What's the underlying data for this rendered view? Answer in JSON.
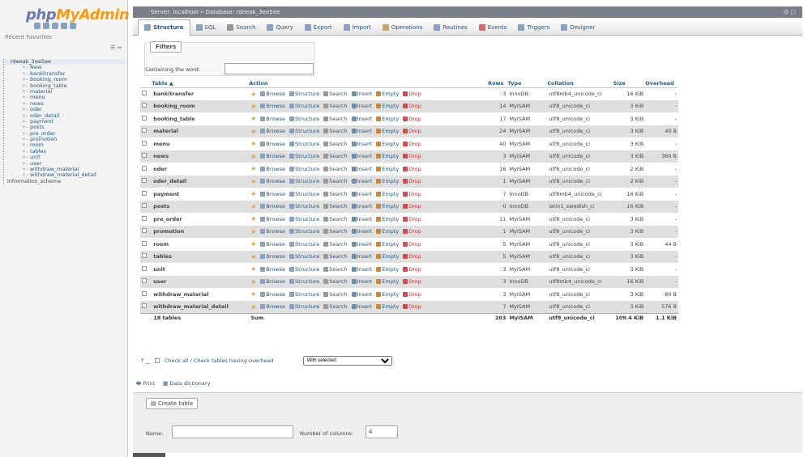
{
  "sidebar": {
    "logo_part1": "php",
    "logo_part2": "MyAdmin",
    "recent_favorites": "Recent   Favorites",
    "collapse": "☰ ⇔",
    "tree": [
      {
        "label": "rdeeak_3ee5ee",
        "type": "root"
      },
      {
        "label": "New",
        "type": "child"
      },
      {
        "label": "bankitransfer",
        "type": "child"
      },
      {
        "label": "booking_room",
        "type": "child"
      },
      {
        "label": "booking_table",
        "type": "child"
      },
      {
        "label": "material",
        "type": "child"
      },
      {
        "label": "menu",
        "type": "child"
      },
      {
        "label": "news",
        "type": "child"
      },
      {
        "label": "oder",
        "type": "child"
      },
      {
        "label": "oder_detail",
        "type": "child"
      },
      {
        "label": "payment",
        "type": "child"
      },
      {
        "label": "posts",
        "type": "child"
      },
      {
        "label": "pre_order",
        "type": "child"
      },
      {
        "label": "promotion",
        "type": "child"
      },
      {
        "label": "room",
        "type": "child"
      },
      {
        "label": "tables",
        "type": "child"
      },
      {
        "label": "unit",
        "type": "child"
      },
      {
        "label": "user",
        "type": "child"
      },
      {
        "label": "withdraw_material",
        "type": "child"
      },
      {
        "label": "withdraw_material_detail",
        "type": "child"
      },
      {
        "label": "information_schema",
        "type": "info"
      }
    ]
  },
  "topbar": {
    "breadcrumb": "Server: localhost » Database: rdeeak_3ee5ee",
    "settings": "⚙ □"
  },
  "tabs": [
    {
      "label": "Structure",
      "color": "#8aa0c0"
    },
    {
      "label": "SQL",
      "color": "#8aa0c0"
    },
    {
      "label": "Search",
      "color": "#999"
    },
    {
      "label": "Query",
      "color": "#8aa0c0"
    },
    {
      "label": "Export",
      "color": "#8aa0c0"
    },
    {
      "label": "Import",
      "color": "#8aa0c0"
    },
    {
      "label": "Operations",
      "color": "#c7a76c"
    },
    {
      "label": "Routines",
      "color": "#8aa0c0"
    },
    {
      "label": "Events",
      "color": "#d56c6c"
    },
    {
      "label": "Triggers",
      "color": "#8aa0c0"
    },
    {
      "label": "Designer",
      "color": "#8aa0c0"
    }
  ],
  "filters": {
    "legend": "Filters",
    "label": "Containing the word:",
    "value": ""
  },
  "table_headers": {
    "table": "Table ▲",
    "action": "Action",
    "rows": "Rows",
    "type": "Type",
    "collation": "Collation",
    "size": "Size",
    "overhead": "Overhead"
  },
  "actions": {
    "browse": "Browse",
    "structure": "Structure",
    "search": "Search",
    "insert": "Insert",
    "empty": "Empty",
    "drop": "Drop"
  },
  "rows": [
    {
      "name": "bankitransfer",
      "rows": "3",
      "type": "InnoDB",
      "collation": "utf8mb4_unicode_ci",
      "size": "16 KiB",
      "overhead": "-"
    },
    {
      "name": "booking_room",
      "rows": "14",
      "type": "MyISAM",
      "collation": "utf8_unicode_ci",
      "size": "3 KiB",
      "overhead": "-"
    },
    {
      "name": "booking_table",
      "rows": "17",
      "type": "MyISAM",
      "collation": "utf8_unicode_ci",
      "size": "3 KiB",
      "overhead": "-"
    },
    {
      "name": "material",
      "rows": "24",
      "type": "MyISAM",
      "collation": "utf8_unicode_ci",
      "size": "3 KiB",
      "overhead": "40 B"
    },
    {
      "name": "menu",
      "rows": "40",
      "type": "MyISAM",
      "collation": "utf8_unicode_ci",
      "size": "3 KiB",
      "overhead": "-"
    },
    {
      "name": "news",
      "rows": "3",
      "type": "MyISAM",
      "collation": "utf8_unicode_ci",
      "size": "3 KiB",
      "overhead": "360 B"
    },
    {
      "name": "oder",
      "rows": "16",
      "type": "MyISAM",
      "collation": "utf8_unicode_ci",
      "size": "2 KiB",
      "overhead": "-"
    },
    {
      "name": "oder_detail",
      "rows": "1",
      "type": "MyISAM",
      "collation": "utf8_unicode_ci",
      "size": "2 KiB",
      "overhead": "-"
    },
    {
      "name": "payment",
      "rows": "7",
      "type": "InnoDB",
      "collation": "utf8mb4_unicode_ci",
      "size": "16 KiB",
      "overhead": "-"
    },
    {
      "name": "posts",
      "rows": "0",
      "type": "InnoDB",
      "collation": "latin1_swedish_ci",
      "size": "16 KiB",
      "overhead": "-"
    },
    {
      "name": "pre_order",
      "rows": "11",
      "type": "MyISAM",
      "collation": "utf8_unicode_ci",
      "size": "3 KiB",
      "overhead": "-"
    },
    {
      "name": "promotion",
      "rows": "1",
      "type": "MyISAM",
      "collation": "utf8_unicode_ci",
      "size": "3 KiB",
      "overhead": "-"
    },
    {
      "name": "room",
      "rows": "5",
      "type": "MyISAM",
      "collation": "utf8_unicode_ci",
      "size": "3 KiB",
      "overhead": "44 B"
    },
    {
      "name": "tables",
      "rows": "5",
      "type": "MyISAM",
      "collation": "utf8_unicode_ci",
      "size": "3 KiB",
      "overhead": "-"
    },
    {
      "name": "unit",
      "rows": "3",
      "type": "MyISAM",
      "collation": "utf8_unicode_ci",
      "size": "3 KiB",
      "overhead": "-"
    },
    {
      "name": "user",
      "rows": "3",
      "type": "InnoDB",
      "collation": "utf8mb4_unicode_ci",
      "size": "16 KiB",
      "overhead": "-"
    },
    {
      "name": "withdraw_material",
      "rows": "3",
      "type": "MyISAM",
      "collation": "utf8_unicode_ci",
      "size": "3 KiB",
      "overhead": "80 B"
    },
    {
      "name": "withdraw_material_detail",
      "rows": "7",
      "type": "MyISAM",
      "collation": "utf8_unicode_ci",
      "size": "3 KiB",
      "overhead": "576 B"
    }
  ],
  "footer": {
    "count": "18 tables",
    "sum": "Sum",
    "rows": "203",
    "type": "MyISAM",
    "collation": "utf8_unicode_ci",
    "size": "109.4 KiB",
    "overhead": "1.1 KiB"
  },
  "bottom": {
    "check_all": "Check all / Check tables having overhead",
    "with_selected": "With selected:"
  },
  "links": {
    "print": "Print",
    "data_dictionary": "Data dictionary"
  },
  "create": {
    "legend": "Create table",
    "name_label": "Name:",
    "cols_label": "Number of columns:",
    "cols_value": "4"
  }
}
